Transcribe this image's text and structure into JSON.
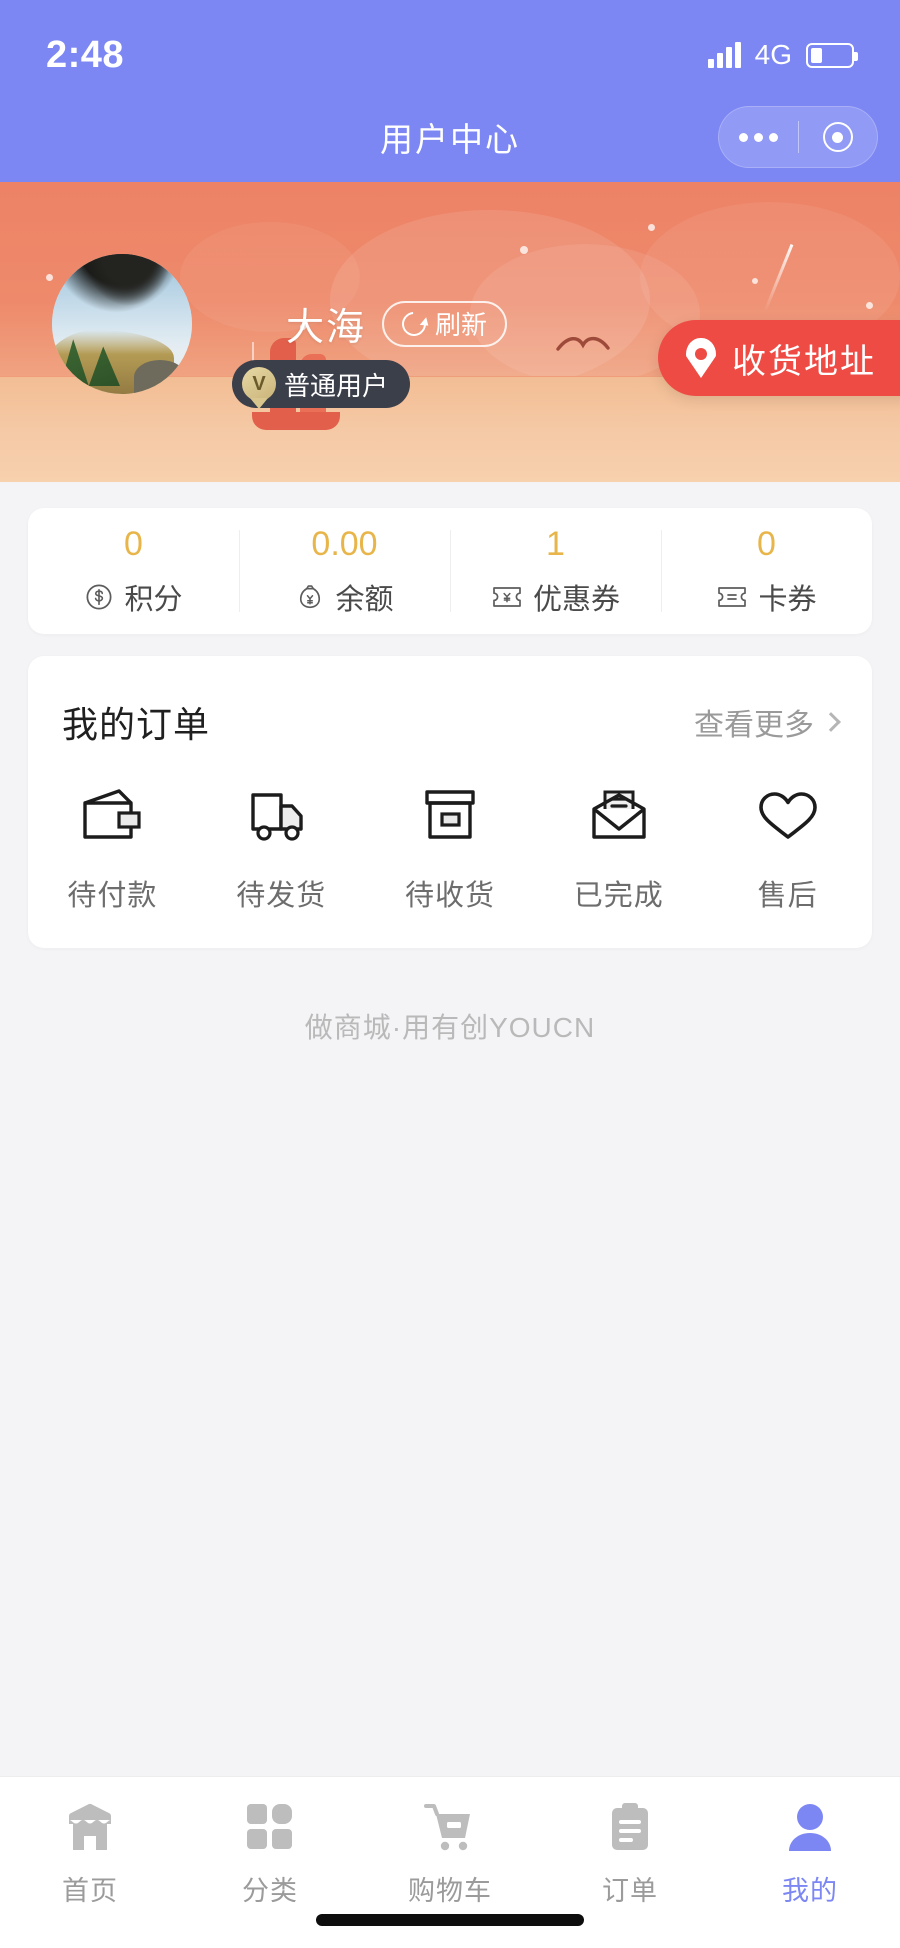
{
  "status_bar": {
    "time": "2:48",
    "network": "4G",
    "signal_icon": "signal-bars-icon",
    "battery_icon": "battery-icon"
  },
  "nav": {
    "title": "用户中心",
    "capsule": {
      "more_icon": "more-dots-icon",
      "target_icon": "target-circle-icon"
    }
  },
  "profile": {
    "avatar_alt": "avatar",
    "balloon_icon": "balloon-icon",
    "username": "大海",
    "refresh_label": "刷新",
    "refresh_icon": "refresh-icon",
    "level_label": "普通用户",
    "level_icon": "medal-icon",
    "address_label": "收货地址",
    "address_icon": "location-pin-icon",
    "address_color": "#EE4B44",
    "banner_colors": {
      "sky_top": "#ED8266",
      "sand": "#F3BE99",
      "water": "#F5C9A5"
    }
  },
  "stats": {
    "accent_color": "#E8B54A",
    "items": [
      {
        "value": "0",
        "label": "积分",
        "icon": "coin-dollar-icon"
      },
      {
        "value": "0.00",
        "label": "余额",
        "icon": "money-bag-icon"
      },
      {
        "value": "1",
        "label": "优惠券",
        "icon": "coupon-ticket-icon"
      },
      {
        "value": "0",
        "label": "卡券",
        "icon": "card-voucher-icon"
      }
    ]
  },
  "orders": {
    "title": "我的订单",
    "more_label": "查看更多",
    "more_icon": "chevron-right-icon",
    "items": [
      {
        "label": "待付款",
        "icon": "wallet-icon"
      },
      {
        "label": "待发货",
        "icon": "truck-icon"
      },
      {
        "label": "待收货",
        "icon": "package-box-icon"
      },
      {
        "label": "已完成",
        "icon": "open-envelope-icon"
      },
      {
        "label": "售后",
        "icon": "heart-icon"
      }
    ]
  },
  "footnote": "做商城·用有创YOUCN",
  "watermark": "https://www.huzhan.com/ishop47020",
  "tabbar": {
    "active_color": "#7C87F4",
    "items": [
      {
        "label": "首页",
        "icon": "store-icon",
        "active": false
      },
      {
        "label": "分类",
        "icon": "grid-icon",
        "active": false
      },
      {
        "label": "购物车",
        "icon": "cart-icon",
        "active": false
      },
      {
        "label": "订单",
        "icon": "clipboard-icon",
        "active": false
      },
      {
        "label": "我的",
        "icon": "person-icon",
        "active": true
      }
    ]
  }
}
